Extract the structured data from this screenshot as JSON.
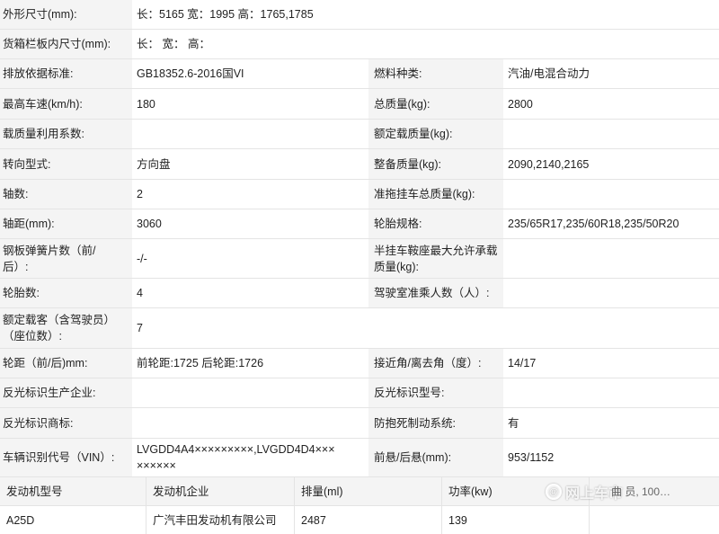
{
  "specs": {
    "dimensions": {
      "label": "外形尺寸(mm):",
      "value": "长：5165 宽：1995 高：1765,1785"
    },
    "cargo": {
      "label": "货箱栏板内尺寸(mm):",
      "value": "长：  宽：  高："
    },
    "emission": {
      "label": "排放依据标准:",
      "value": "GB18352.6-2016国VI",
      "label2": "燃料种类:",
      "value2": "汽油/电混合动力"
    },
    "speed": {
      "label": "最高车速(km/h):",
      "value": "180",
      "label2": "总质量(kg):",
      "value2": "2800"
    },
    "load_util": {
      "label": "载质量利用系数:",
      "value": "",
      "label2": "额定载质量(kg):",
      "value2": ""
    },
    "steering": {
      "label": "转向型式:",
      "value": "方向盘",
      "label2": "整备质量(kg):",
      "value2": "2090,2140,2165"
    },
    "axles": {
      "label": "轴数:",
      "value": "2",
      "label2": "准拖挂车总质量(kg):",
      "value2": ""
    },
    "wheelbase": {
      "label": "轴距(mm):",
      "value": "3060",
      "label2": "轮胎规格:",
      "value2": "235/65R17,235/60R18,235/50R20"
    },
    "springs": {
      "label_a": "钢板弹簧片数（前/",
      "label_b": "后）:",
      "value": "-/-",
      "label2_a": "半挂车鞍座最大允许承载",
      "label2_b": "质量(kg):",
      "value2": ""
    },
    "tires": {
      "label": "轮胎数:",
      "value": "4",
      "label2": "驾驶室准乘人数（人）:",
      "value2": ""
    },
    "seats": {
      "label_a": "额定载客（含驾驶员）",
      "label_b": "（座位数）:",
      "value": "7"
    },
    "track": {
      "label": "轮距（前/后)mm:",
      "value": "前轮距:1725 后轮距:1726",
      "label2": "接近角/离去角（度）:",
      "value2": "14/17"
    },
    "reflect_maker": {
      "label": "反光标识生产企业:",
      "value": "",
      "label2": "反光标识型号:",
      "value2": ""
    },
    "reflect_brand": {
      "label": "反光标识商标:",
      "value": "",
      "label2": "防抱死制动系统:",
      "value2": "有"
    },
    "vin": {
      "label": "车辆识别代号（VIN）:",
      "value_a": "LVGDD4A4×××××××××,LVGDD4D4×××",
      "value_b": "××××××",
      "label2": "前悬/后悬(mm):",
      "value2": "953/1152"
    }
  },
  "engine_table": {
    "headers": [
      "发动机型号",
      "发动机企业",
      "排量(ml)",
      "功率(kw)"
    ],
    "row": [
      "A25D",
      "广汽丰田发动机有限公司",
      "2487",
      "139"
    ]
  },
  "watermark": {
    "text": "网上车市",
    "icon": "at-circle-icon",
    "behind": "曲 员, 100…"
  }
}
